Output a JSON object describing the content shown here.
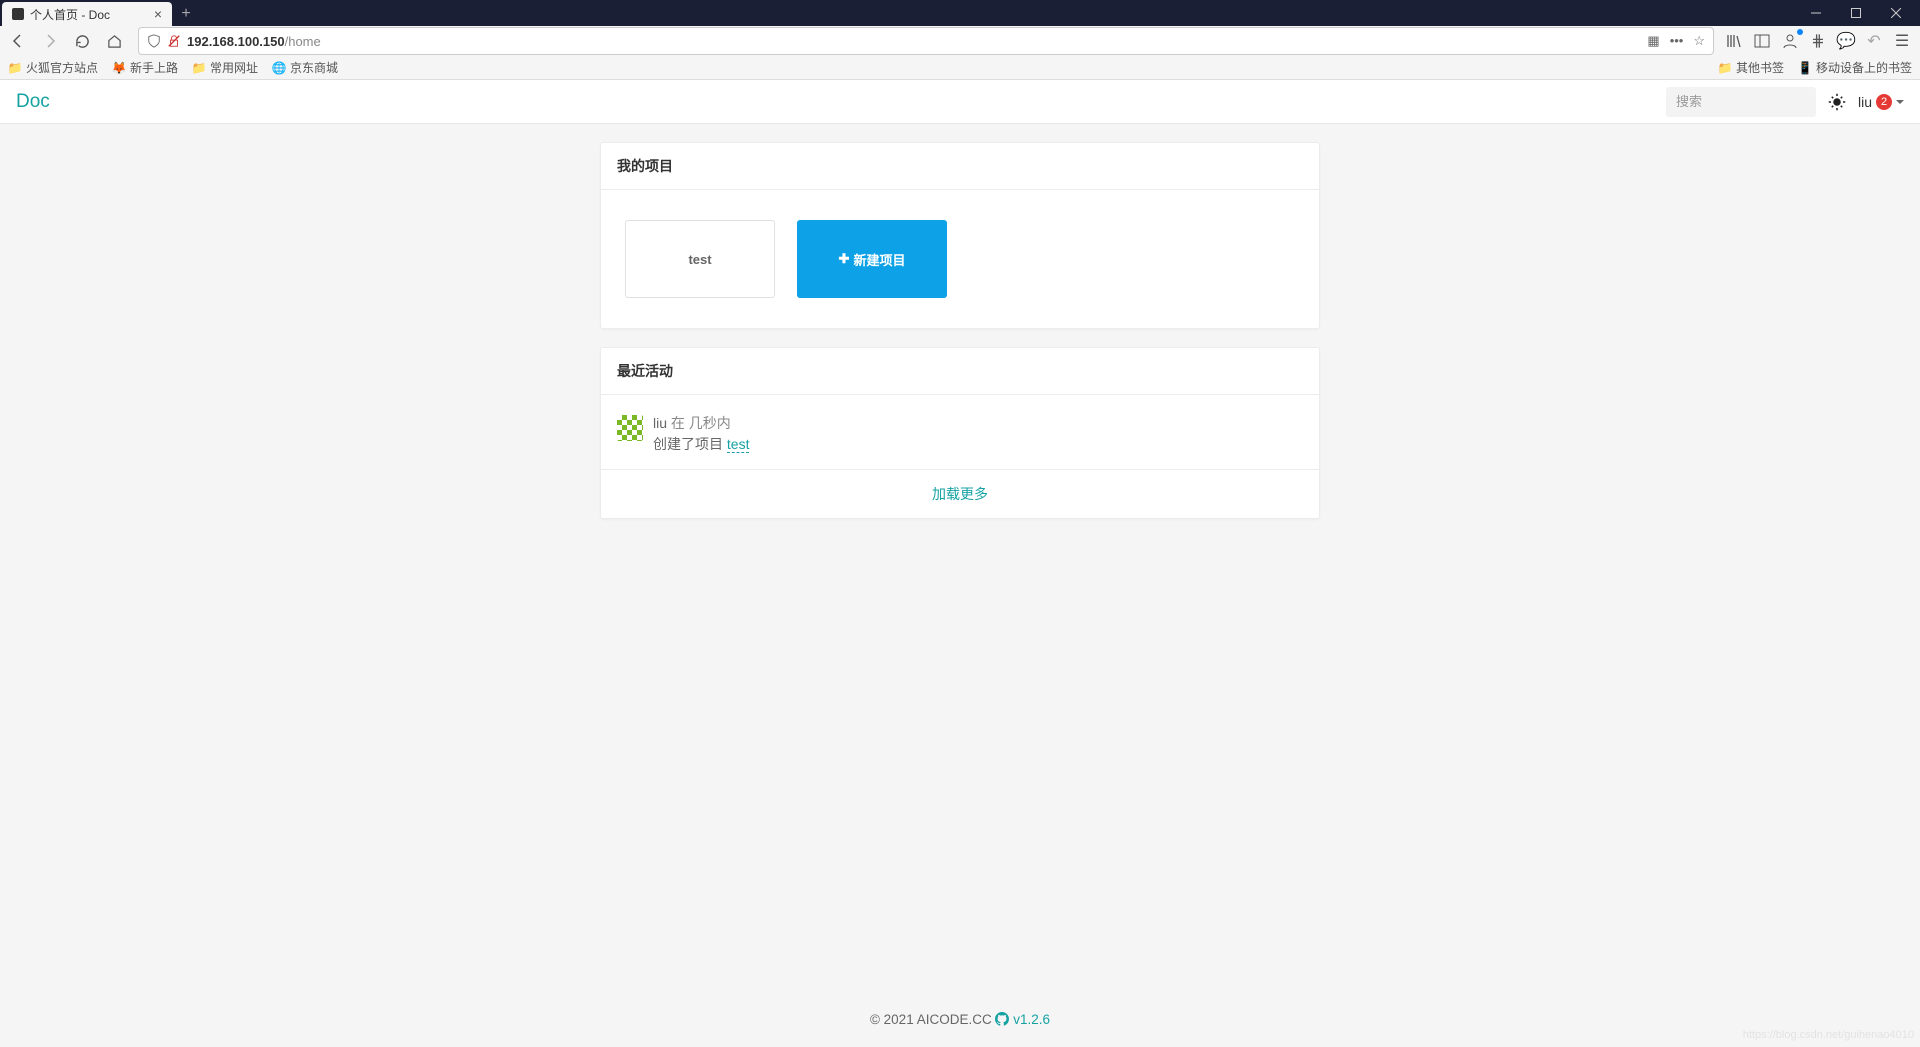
{
  "browser": {
    "tab_title": "个人首页 - Doc",
    "url_host": "192.168.100.150",
    "url_path": "/home",
    "bookmarks_left": [
      "火狐官方站点",
      "新手上路",
      "常用网址",
      "京东商城"
    ],
    "bookmarks_right": [
      "其他书签",
      "移动设备上的书签"
    ]
  },
  "header": {
    "logo": "Doc",
    "search_placeholder": "搜索",
    "user": "liu",
    "notif_count": "2"
  },
  "projects": {
    "title": "我的项目",
    "items": [
      "test"
    ],
    "new_label": "新建项目"
  },
  "activity": {
    "title": "最近活动",
    "item": {
      "user": "liu",
      "when": "在 几秒内",
      "action": "创建了项目",
      "target": "test"
    },
    "load_more": "加载更多"
  },
  "footer": {
    "copyright": "© 2021 AICODE.CC",
    "version": "v1.2.6"
  },
  "watermark": "https://blog.csdn.net/guihenao4010"
}
